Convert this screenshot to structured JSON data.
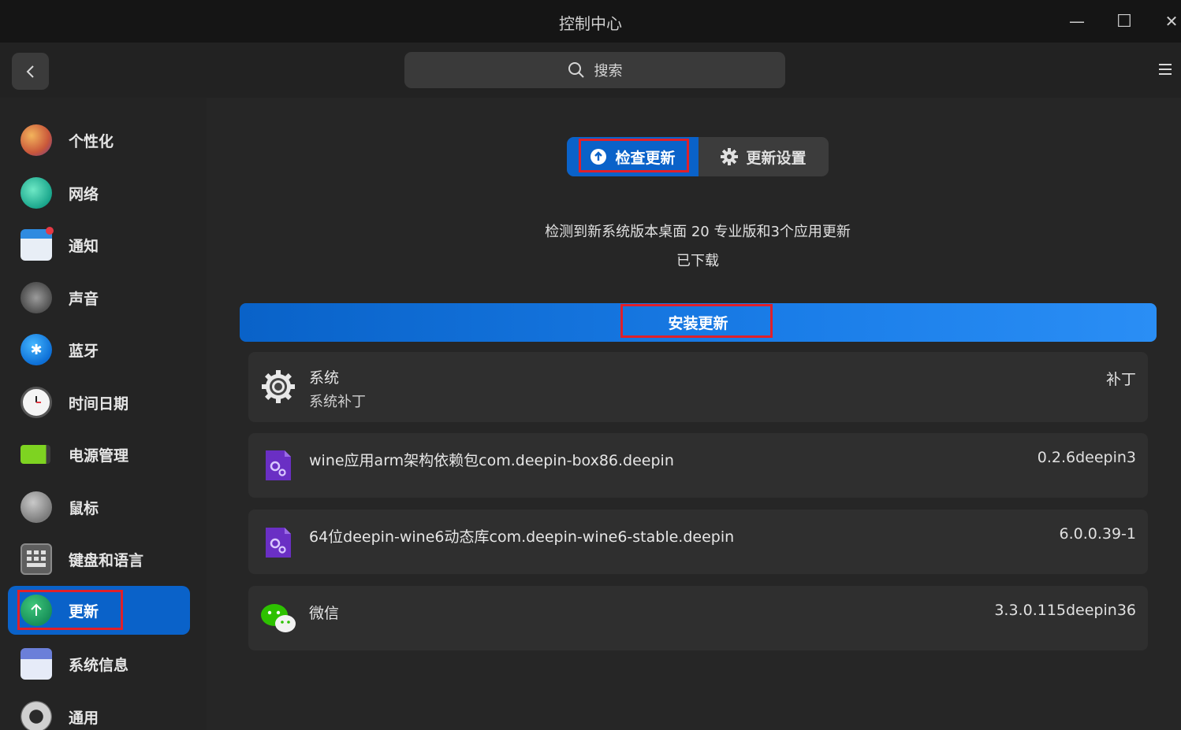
{
  "window": {
    "title": "控制中心",
    "minimize_glyph": "—",
    "maximize_glyph": "☐",
    "close_glyph": "✕"
  },
  "toolbar": {
    "search_label": "搜索"
  },
  "sidebar": {
    "items": [
      {
        "label": "个性化",
        "icon": "palette-icon"
      },
      {
        "label": "网络",
        "icon": "network-icon"
      },
      {
        "label": "通知",
        "icon": "notification-icon"
      },
      {
        "label": "声音",
        "icon": "speaker-icon"
      },
      {
        "label": "蓝牙",
        "icon": "bluetooth-icon"
      },
      {
        "label": "时间日期",
        "icon": "clock-icon"
      },
      {
        "label": "电源管理",
        "icon": "battery-icon"
      },
      {
        "label": "鼠标",
        "icon": "mouse-icon"
      },
      {
        "label": "键盘和语言",
        "icon": "keyboard-icon"
      },
      {
        "label": "更新",
        "icon": "update-icon",
        "active": true
      },
      {
        "label": "系统信息",
        "icon": "system-info-icon"
      },
      {
        "label": "通用",
        "icon": "general-icon"
      }
    ]
  },
  "main": {
    "tabs": [
      {
        "label": "检查更新",
        "active": true
      },
      {
        "label": "更新设置"
      }
    ],
    "status_line": "检测到新系统版本桌面 20 专业版和3个应用更新",
    "status_sub": "已下载",
    "install_button": "安装更新",
    "updates": [
      {
        "name": "系统",
        "subtitle": "系统补丁",
        "version": "补丁",
        "icon": "gear-icon"
      },
      {
        "name": "wine应用arm架构依赖包com.deepin-box86.deepin",
        "version": "0.2.6deepin3",
        "icon": "package-icon"
      },
      {
        "name": "64位deepin-wine6动态库com.deepin-wine6-stable.deepin",
        "version": "6.0.0.39-1",
        "icon": "package-icon"
      },
      {
        "name": "微信",
        "version": "3.3.0.115deepin36",
        "icon": "wechat-icon"
      }
    ]
  },
  "colors": {
    "accent": "#0a62c9",
    "highlight_box": "#e0202a"
  }
}
